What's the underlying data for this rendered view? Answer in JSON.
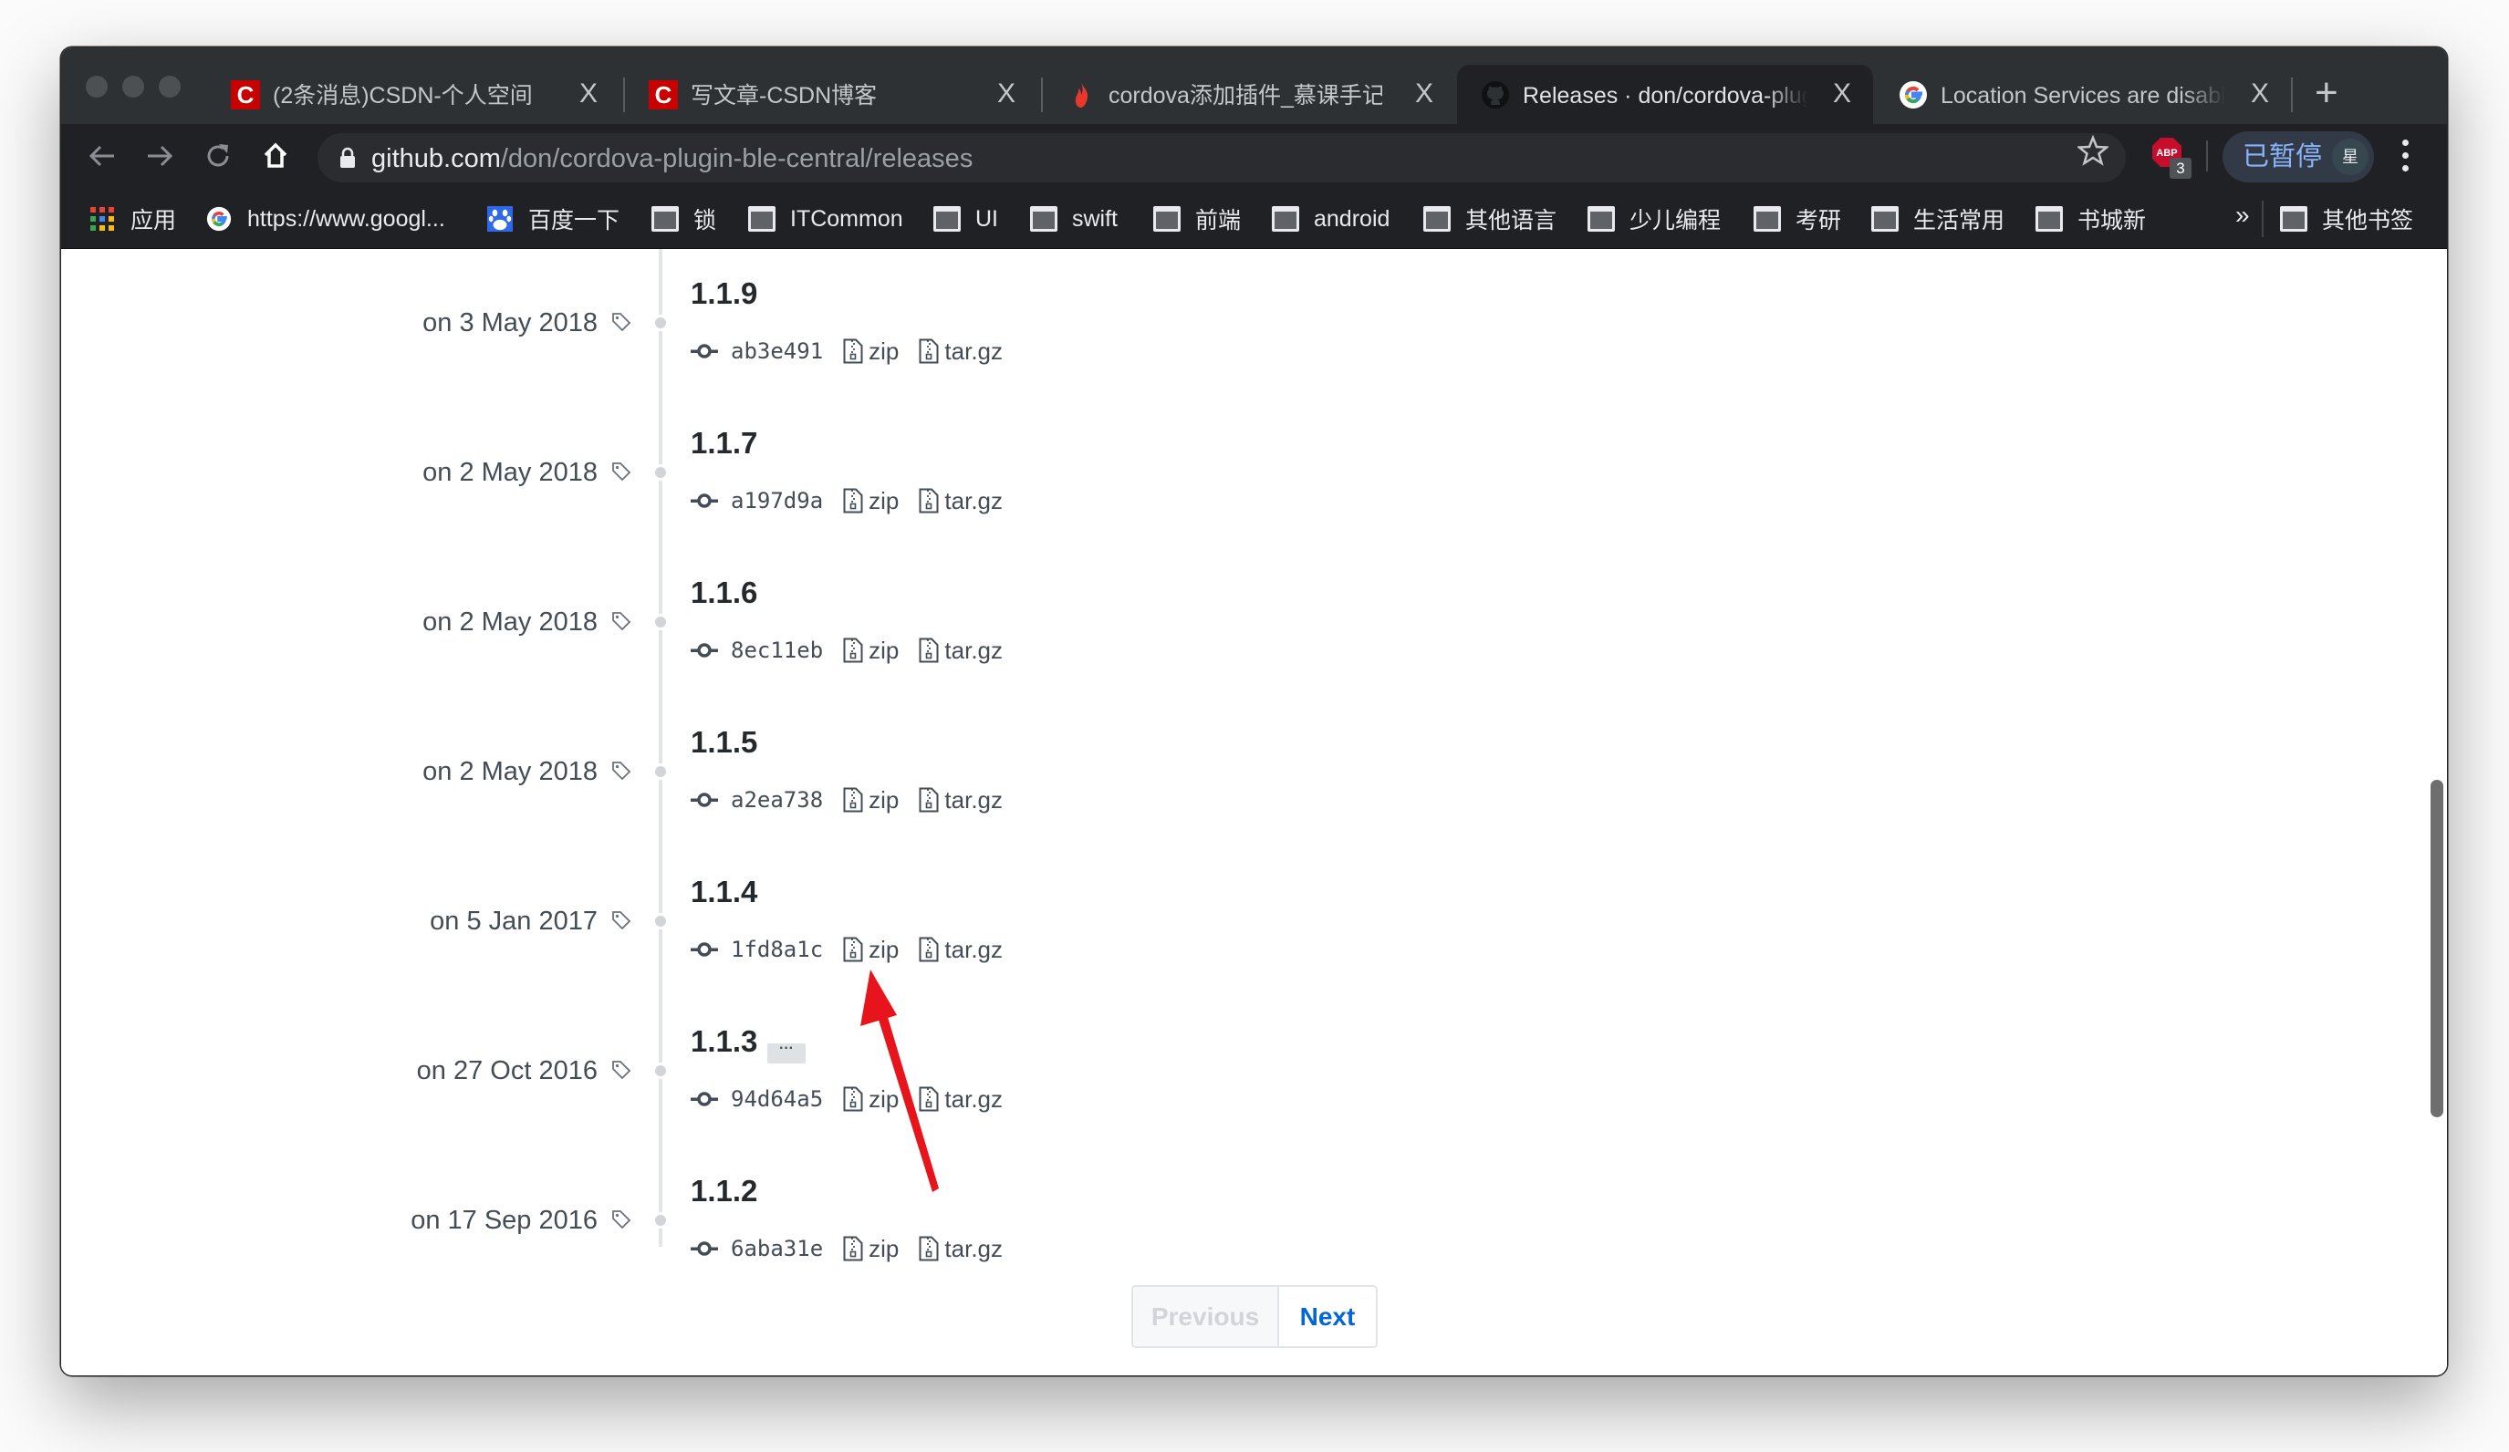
{
  "browser": {
    "tabs": [
      {
        "title": "(2条消息)CSDN-个人空间",
        "icon": "csdn-icon",
        "active": false
      },
      {
        "title": "写文章-CSDN博客",
        "icon": "csdn-icon",
        "active": false
      },
      {
        "title": "cordova添加插件_慕课手记",
        "icon": "flame-icon",
        "active": false
      },
      {
        "title": "Releases · don/cordova-plug",
        "icon": "github-icon",
        "active": true
      },
      {
        "title": "Location Services are disable",
        "icon": "google-icon",
        "active": false
      }
    ],
    "tab_close_glyph": "X",
    "new_tab_glyph": "+",
    "url_host": "github.com",
    "url_path": "/don/cordova-plugin-ble-central/releases",
    "abp_badge": "3",
    "abp_label": "ABP",
    "profile_label": "已暂停",
    "profile_avatar": "星",
    "csdn_glyph": "C"
  },
  "bookmarks": {
    "items": [
      {
        "label": "应用",
        "icon": "apps-grid-icon"
      },
      {
        "label": "https://www.googl...",
        "icon": "google-icon"
      },
      {
        "label": "百度一下",
        "icon": "baidu-paw-icon"
      },
      {
        "label": "锁",
        "icon": "folder-icon"
      },
      {
        "label": "ITCommon",
        "icon": "folder-icon"
      },
      {
        "label": "UI",
        "icon": "folder-icon"
      },
      {
        "label": "swift",
        "icon": "folder-icon"
      },
      {
        "label": "前端",
        "icon": "folder-icon"
      },
      {
        "label": "android",
        "icon": "folder-icon"
      },
      {
        "label": "其他语言",
        "icon": "folder-icon"
      },
      {
        "label": "少儿编程",
        "icon": "folder-icon"
      },
      {
        "label": "考研",
        "icon": "folder-icon"
      },
      {
        "label": "生活常用",
        "icon": "folder-icon"
      },
      {
        "label": "书城新",
        "icon": "folder-icon"
      }
    ],
    "overflow_glyph": "»",
    "other_bookmarks": "其他书签"
  },
  "releases": [
    {
      "version": "1.1.9",
      "date": "on 3 May 2018",
      "commit": "ab3e491",
      "zip": "zip",
      "targz": "tar.gz",
      "has_more": false
    },
    {
      "version": "1.1.7",
      "date": "on 2 May 2018",
      "commit": "a197d9a",
      "zip": "zip",
      "targz": "tar.gz",
      "has_more": false
    },
    {
      "version": "1.1.6",
      "date": "on 2 May 2018",
      "commit": "8ec11eb",
      "zip": "zip",
      "targz": "tar.gz",
      "has_more": false
    },
    {
      "version": "1.1.5",
      "date": "on 2 May 2018",
      "commit": "a2ea738",
      "zip": "zip",
      "targz": "tar.gz",
      "has_more": false
    },
    {
      "version": "1.1.4",
      "date": "on 5 Jan 2017",
      "commit": "1fd8a1c",
      "zip": "zip",
      "targz": "tar.gz",
      "has_more": false
    },
    {
      "version": "1.1.3",
      "date": "on 27 Oct 2016",
      "commit": "94d64a5",
      "zip": "zip",
      "targz": "tar.gz",
      "has_more": true,
      "more_glyph": "···"
    },
    {
      "version": "1.1.2",
      "date": "on 17 Sep 2016",
      "commit": "6aba31e",
      "zip": "zip",
      "targz": "tar.gz",
      "has_more": false
    }
  ],
  "pagination": {
    "previous": "Previous",
    "next": "Next"
  },
  "colors": {
    "annotation_arrow": "#e8141b",
    "link": "#0366d6",
    "csdn_red": "#c90000"
  }
}
